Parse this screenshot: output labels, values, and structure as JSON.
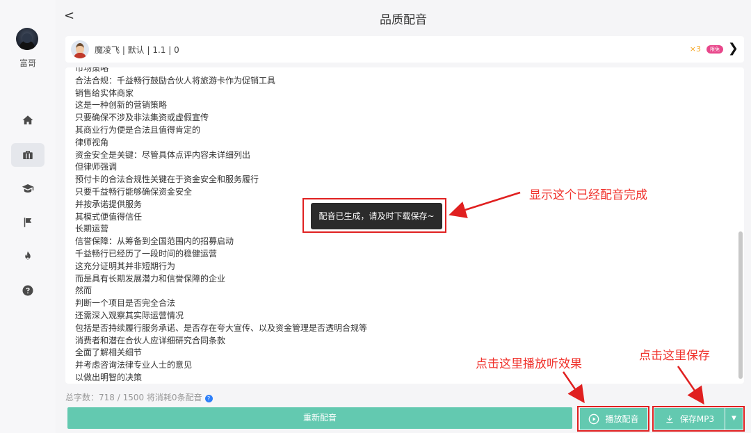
{
  "sidebar": {
    "user_name": "富哥",
    "items": [
      {
        "icon": "home-icon"
      },
      {
        "icon": "briefcase-icon",
        "active": true
      },
      {
        "icon": "graduation-cap-icon"
      },
      {
        "icon": "flag-icon"
      },
      {
        "icon": "fire-icon"
      },
      {
        "icon": "help-circle-icon"
      }
    ]
  },
  "header": {
    "back_glyph": "<",
    "title": "品质配音"
  },
  "voice": {
    "info": "魔凌飞 | 默认 | 1.1 | 0",
    "multiplier": "×3",
    "badge": "限免",
    "chevron": "❯"
  },
  "content": {
    "lines": [
      "市场策略",
      "合法合规：千益畅行鼓励合伙人将旅游卡作为促销工具",
      "销售给实体商家",
      "这是一种创新的营销策略",
      "只要确保不涉及非法集资或虚假宣传",
      "其商业行为便是合法且值得肯定的",
      "律师视角",
      "资金安全是关键：尽管具体点评内容未详细列出",
      "但律师强调",
      "预付卡的合法合规性关键在于资金安全和服务履行",
      "只要千益畅行能够确保资金安全",
      "并按承诺提供服务",
      "其模式便值得信任",
      "长期运营",
      "信誉保障：从筹备到全国范围内的招募启动",
      "千益畅行已经历了一段时间的稳健运营",
      "这充分证明其并非短期行为",
      "而是具有长期发展潜力和信誉保障的企业",
      "然而",
      "判断一个项目是否完全合法",
      "还需深入观察其实际运营情况",
      "包括是否持续履行服务承诺、是否存在夸大宣传、以及资金管理是否透明合规等",
      "消费者和潜在合伙人应详细研究合同条款",
      "全面了解相关细节",
      "并考虑咨询法律专业人士的意见",
      "以做出明智的决策"
    ]
  },
  "toast": {
    "message": "配音已生成，请及时下载保存~"
  },
  "counter": {
    "text": "总字数：718 / 1500   将消耗0条配音",
    "help": "?"
  },
  "actions": {
    "regenerate_label": "重新配音",
    "play_label": "播放配音",
    "save_label": "保存MP3",
    "save_caret": "▼"
  },
  "annotations": {
    "done": "显示这个已经配音完成",
    "play": "点击这里播放听效果",
    "save": "点击这里保存"
  },
  "colors": {
    "accent": "#63c9b0",
    "annotation": "#e02020",
    "badge": "#e8478b",
    "multiplier": "#f5a623"
  }
}
